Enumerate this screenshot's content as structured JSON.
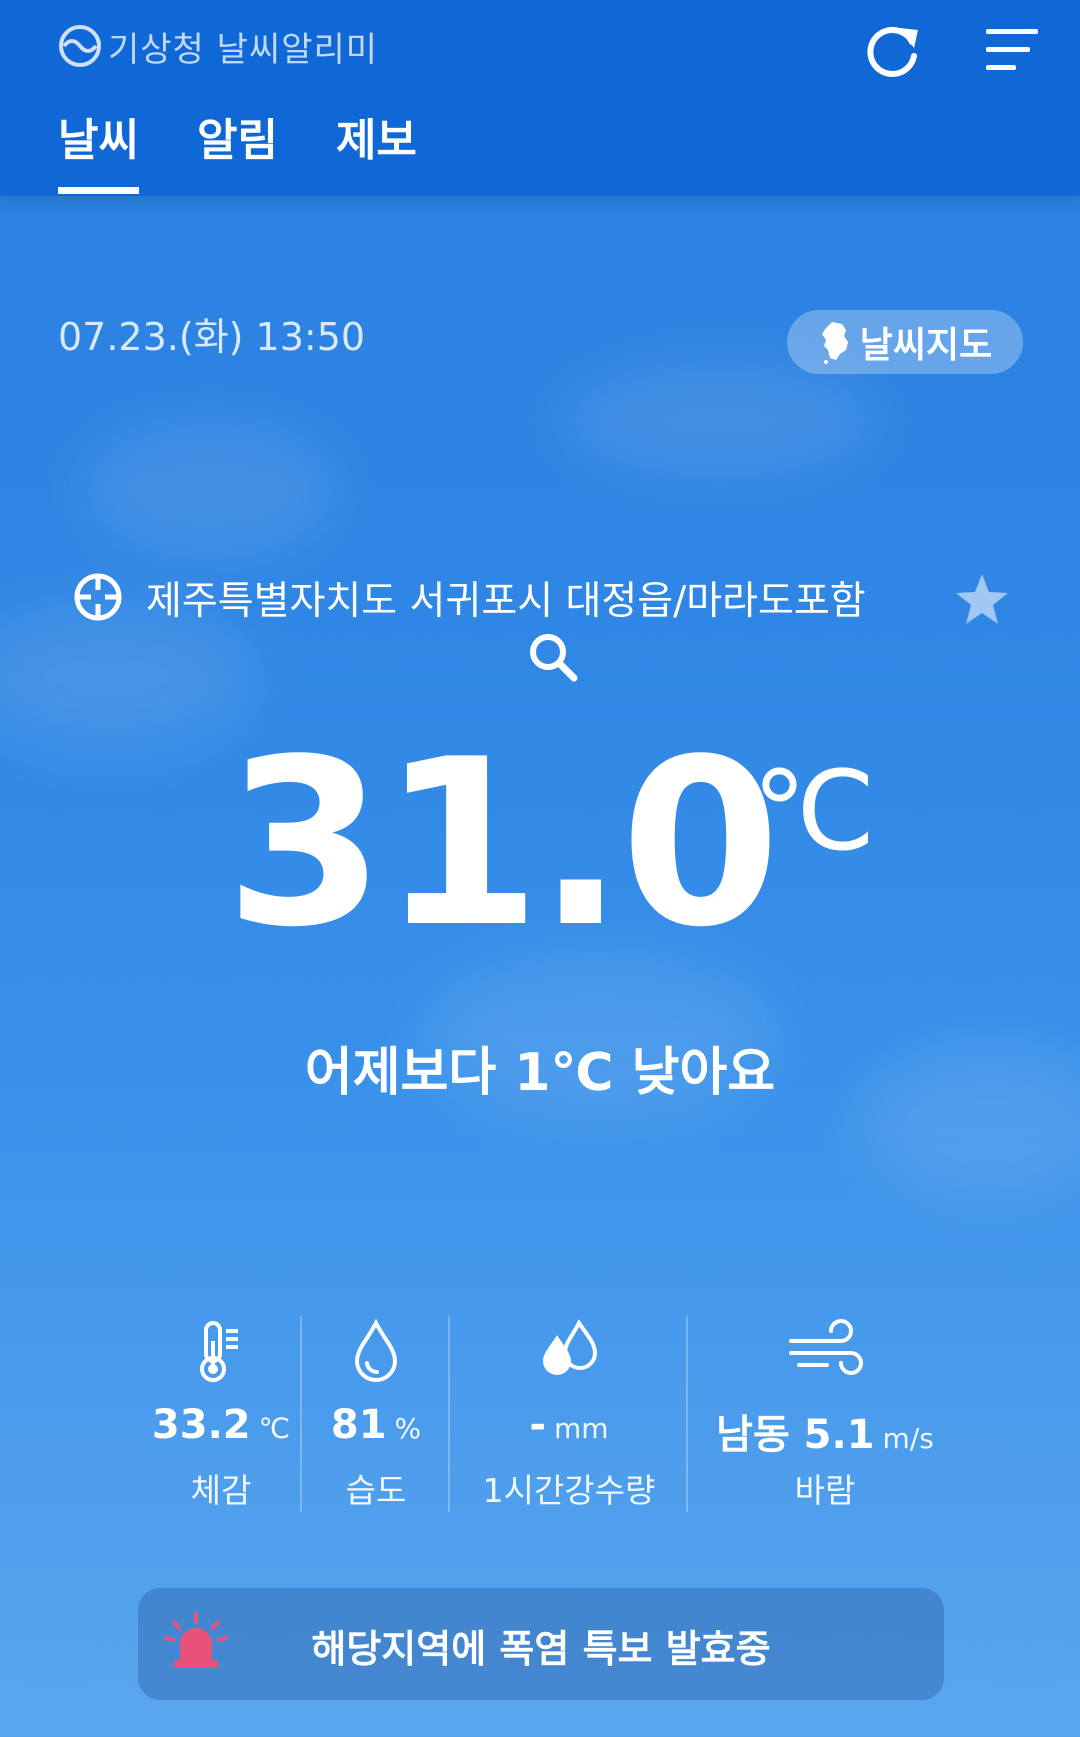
{
  "header": {
    "brand": "기상청 날씨알리미",
    "tabs": [
      {
        "label": "날씨",
        "active": true
      },
      {
        "label": "알림",
        "active": false
      },
      {
        "label": "제보",
        "active": false
      }
    ],
    "icons": [
      "refresh-icon",
      "hamburger-menu-icon"
    ]
  },
  "datetime": "07.23.(화) 13:50",
  "map_button": {
    "label": "날씨지도",
    "icon": "korea-map-icon"
  },
  "location": {
    "name": "제주특별자치도 서귀포시 대정읍/마라도포함",
    "icons": [
      "crosshair-icon",
      "star-icon",
      "search-icon"
    ]
  },
  "temperature": {
    "value": "31.0",
    "unit": "℃"
  },
  "comparison": "어제보다 1℃ 낮아요",
  "stats": [
    {
      "id": "feels",
      "value": "33.2",
      "unit": "℃",
      "label": "체감",
      "icon": "thermometer-icon"
    },
    {
      "id": "humidity",
      "value": "81",
      "unit": "%",
      "label": "습도",
      "icon": "water-drop-icon"
    },
    {
      "id": "rain",
      "value": "-",
      "unit": "mm",
      "label": "1시간강수량",
      "icon": "rain-drops-icon"
    },
    {
      "id": "wind",
      "value": "남동 5.1",
      "unit": "m/s",
      "label": "바람",
      "icon": "wind-icon"
    }
  ],
  "alert": {
    "text": "해당지역에 폭염 특보 발효중",
    "icon": "siren-icon",
    "icon_color": "#e8527a"
  },
  "colors": {
    "header": "#0f68d6",
    "background": "#2f86e4"
  }
}
